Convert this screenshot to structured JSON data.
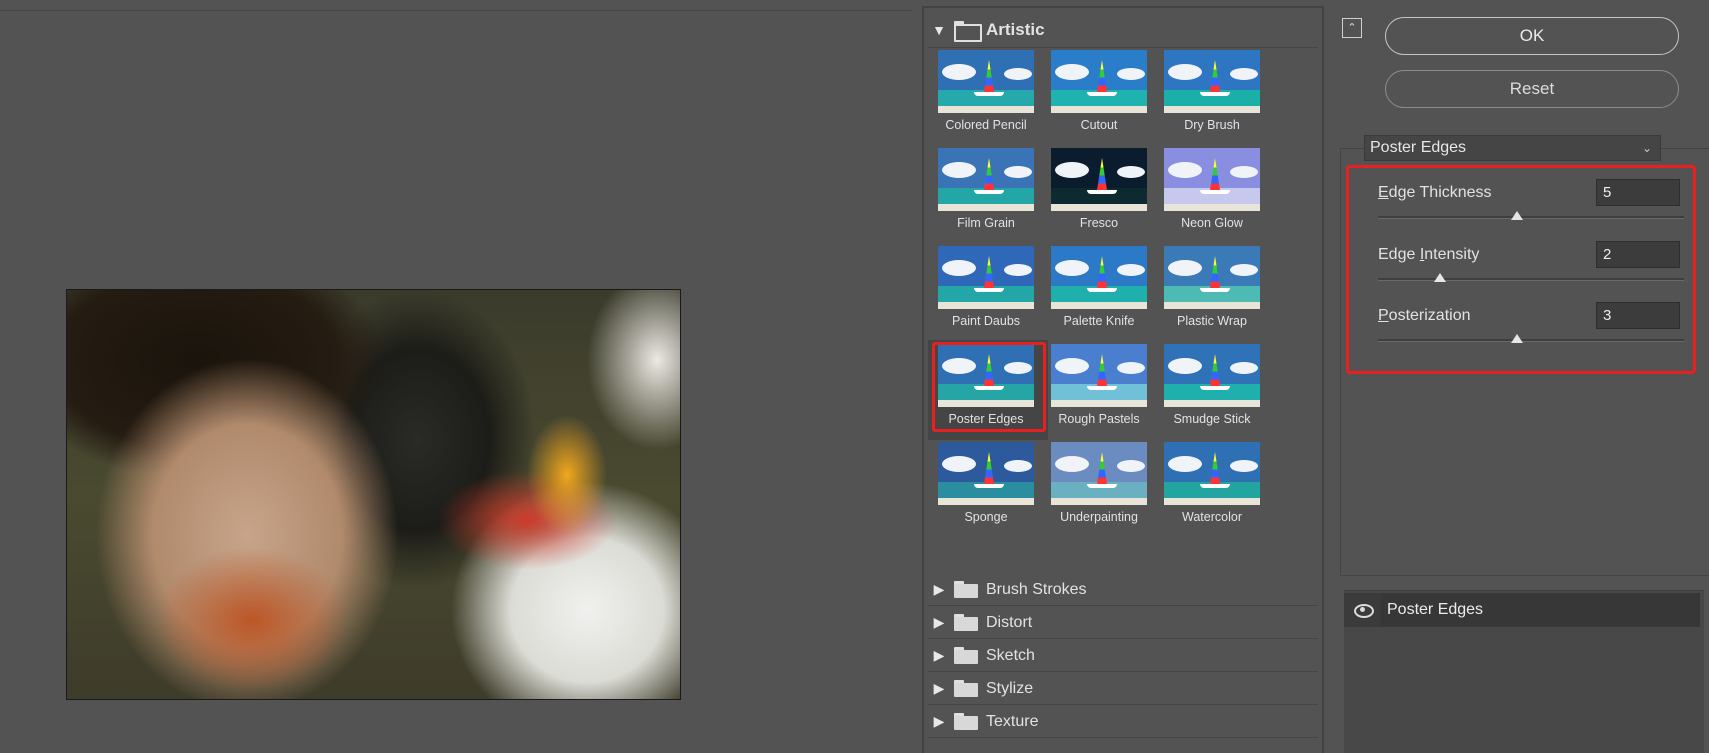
{
  "gallery": {
    "open_category": "Artistic",
    "filters": [
      {
        "label": "Colored Pencil"
      },
      {
        "label": "Cutout"
      },
      {
        "label": "Dry Brush"
      },
      {
        "label": "Film Grain"
      },
      {
        "label": "Fresco"
      },
      {
        "label": "Neon Glow"
      },
      {
        "label": "Paint Daubs"
      },
      {
        "label": "Palette Knife"
      },
      {
        "label": "Plastic Wrap"
      },
      {
        "label": "Poster Edges"
      },
      {
        "label": "Rough Pastels"
      },
      {
        "label": "Smudge Stick"
      },
      {
        "label": "Sponge"
      },
      {
        "label": "Underpainting"
      },
      {
        "label": "Watercolor"
      }
    ],
    "selected_filter": "Poster Edges",
    "collapsed_categories": [
      "Brush Strokes",
      "Distort",
      "Sketch",
      "Stylize",
      "Texture"
    ]
  },
  "buttons": {
    "ok": "OK",
    "reset": "Reset"
  },
  "settings": {
    "filter_select_value": "Poster Edges",
    "params": [
      {
        "label": "Edge Thickness",
        "mnemonic": "E",
        "value": "5",
        "level_fraction": 0.5
      },
      {
        "label": "Edge Intensity",
        "mnemonic": "I",
        "value": "2",
        "level_fraction": 0.2
      },
      {
        "label": "Posterization",
        "mnemonic": "P",
        "value": "3",
        "level_fraction": 0.5
      }
    ]
  },
  "layers": {
    "effect_layer": "Poster Edges"
  },
  "colors": {
    "highlight": "#e82020",
    "background": "#535353"
  },
  "icons": {
    "collapse": "chevrons-up-icon",
    "visibility": "eye-icon",
    "folder": "folder-icon"
  }
}
